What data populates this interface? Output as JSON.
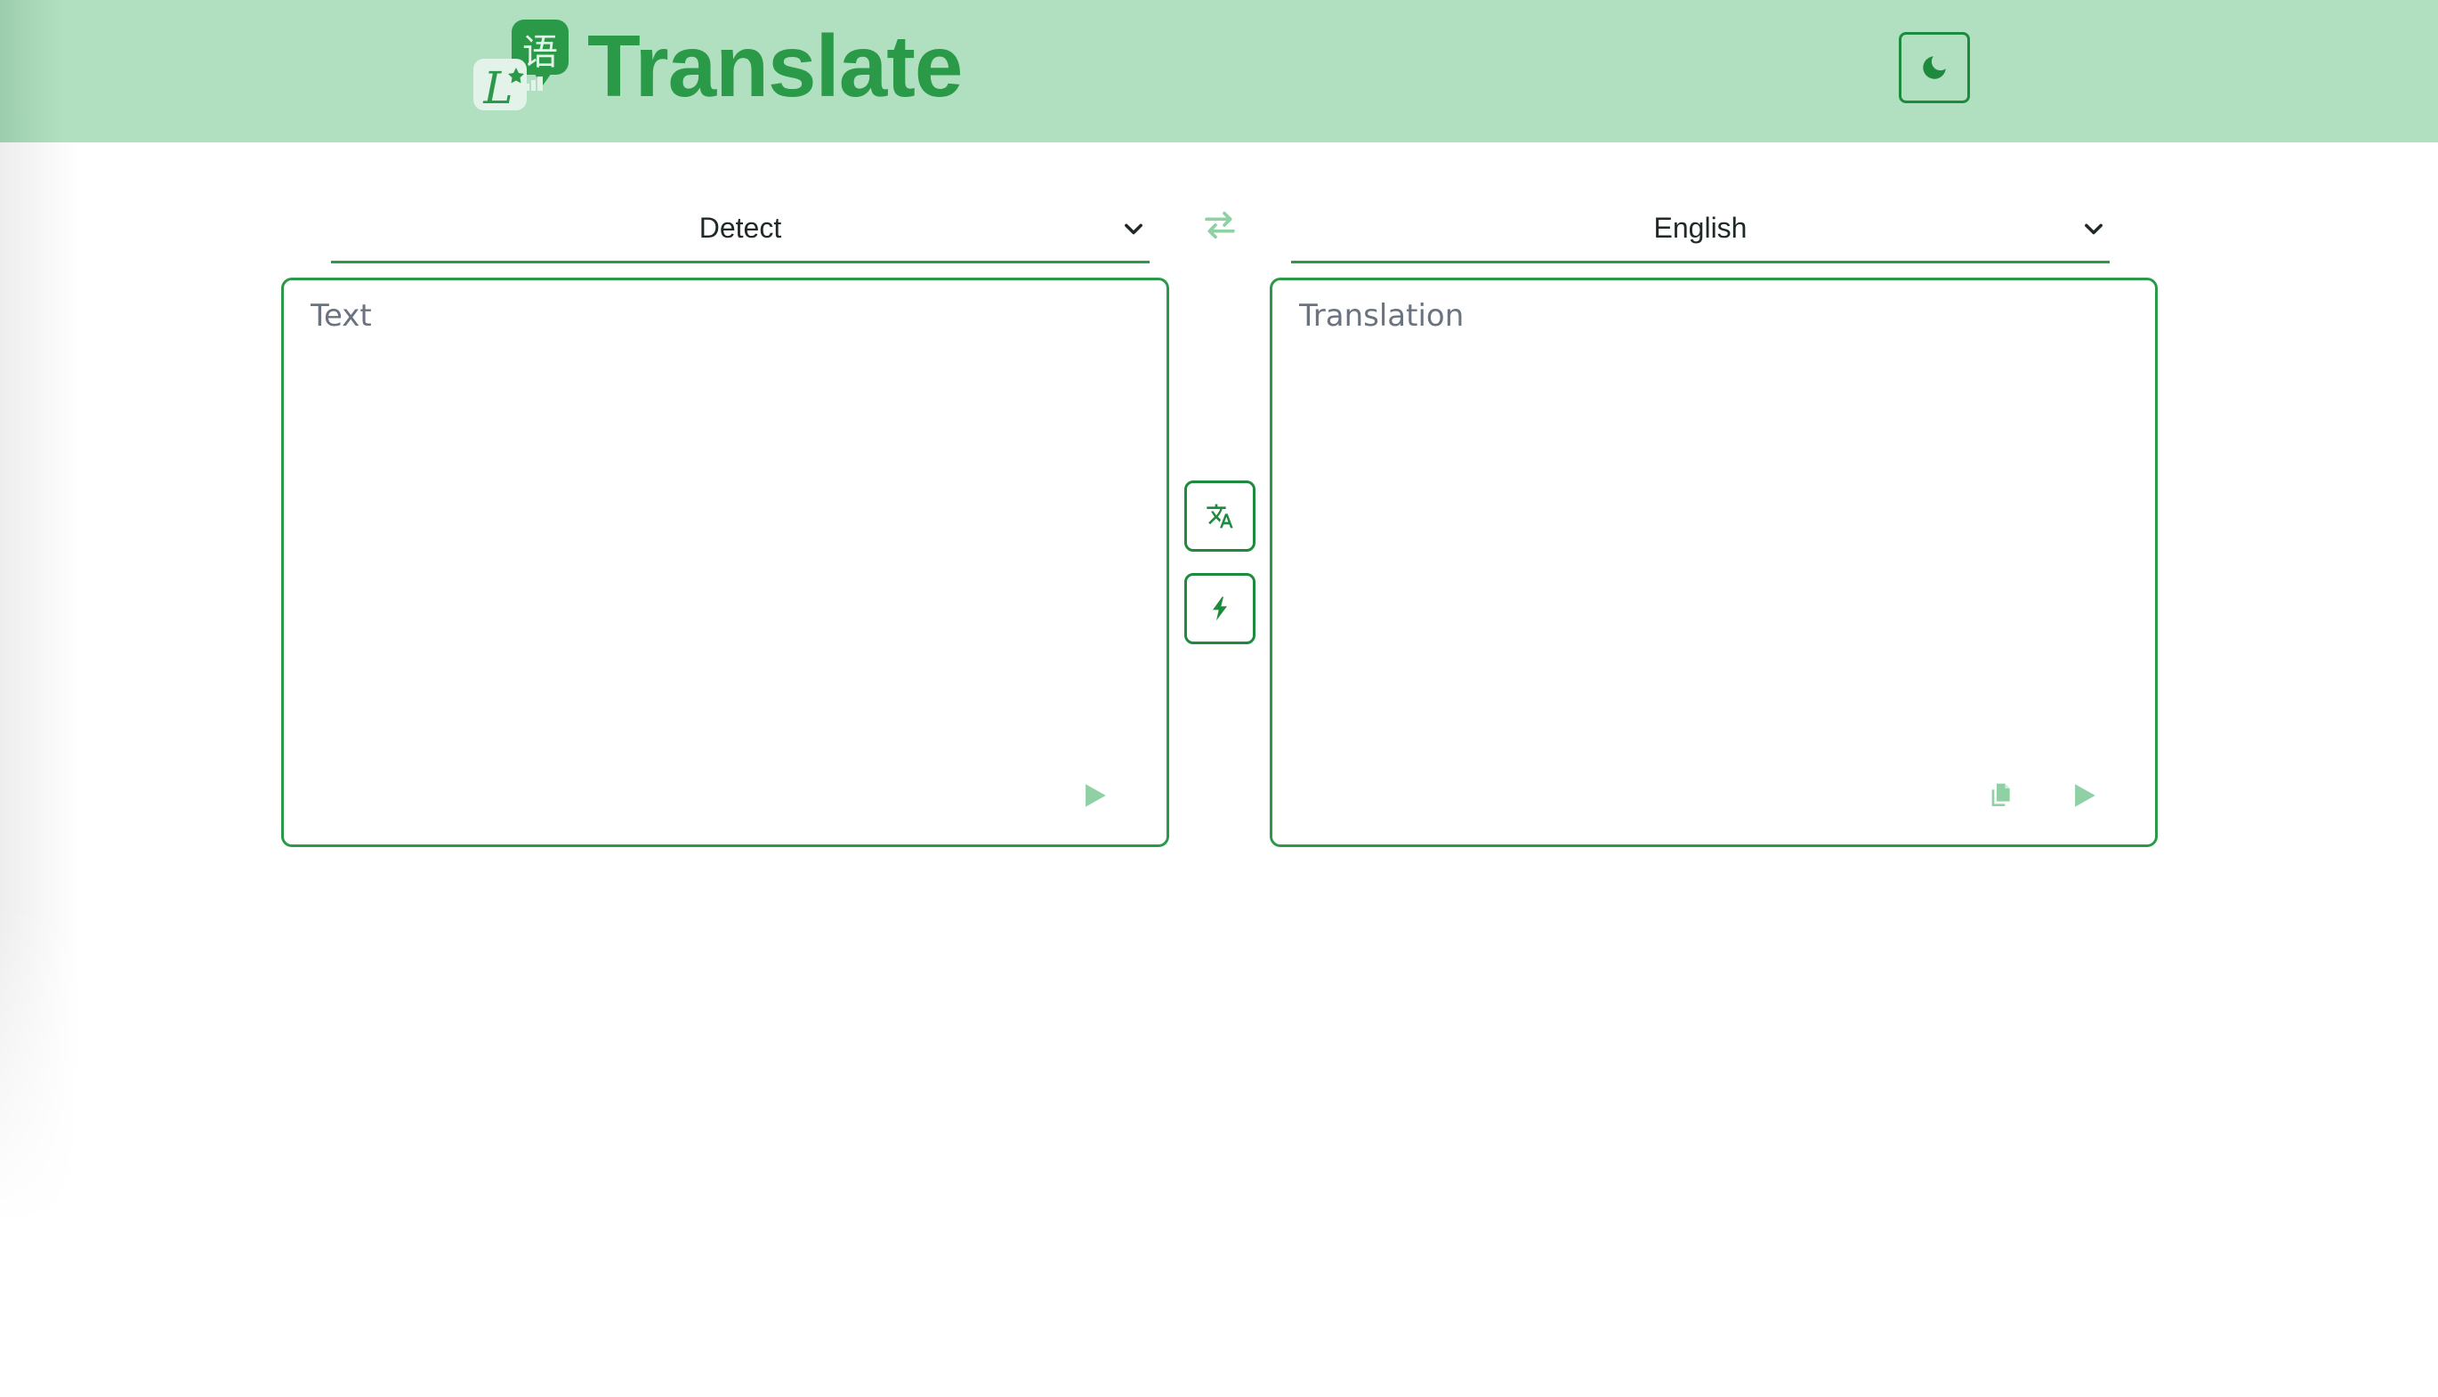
{
  "header": {
    "app_title": "Translate",
    "logo_glyph_cjk": "语",
    "logo_glyph_latin": "L",
    "theme_toggle_icon": "moon-icon"
  },
  "selectors": {
    "source": {
      "label": "Detect",
      "icon": "chevron-down-icon"
    },
    "target": {
      "label": "English",
      "icon": "chevron-down-icon"
    },
    "swap_icon": "swap-arrows-icon"
  },
  "source_panel": {
    "placeholder": "Text",
    "value": "",
    "play_icon": "play-icon"
  },
  "target_panel": {
    "placeholder": "Translation",
    "value": "",
    "copy_icon": "copy-icon",
    "play_icon": "play-icon"
  },
  "actions": {
    "translate_icon": "translate-icon",
    "instant_icon": "lightning-icon"
  },
  "colors": {
    "header_bg": "#b0e0c0",
    "accent": "#2a9a48",
    "accent_dark": "#1e8a3e",
    "accent_light": "#8fd0a4",
    "placeholder": "#6b7280"
  }
}
